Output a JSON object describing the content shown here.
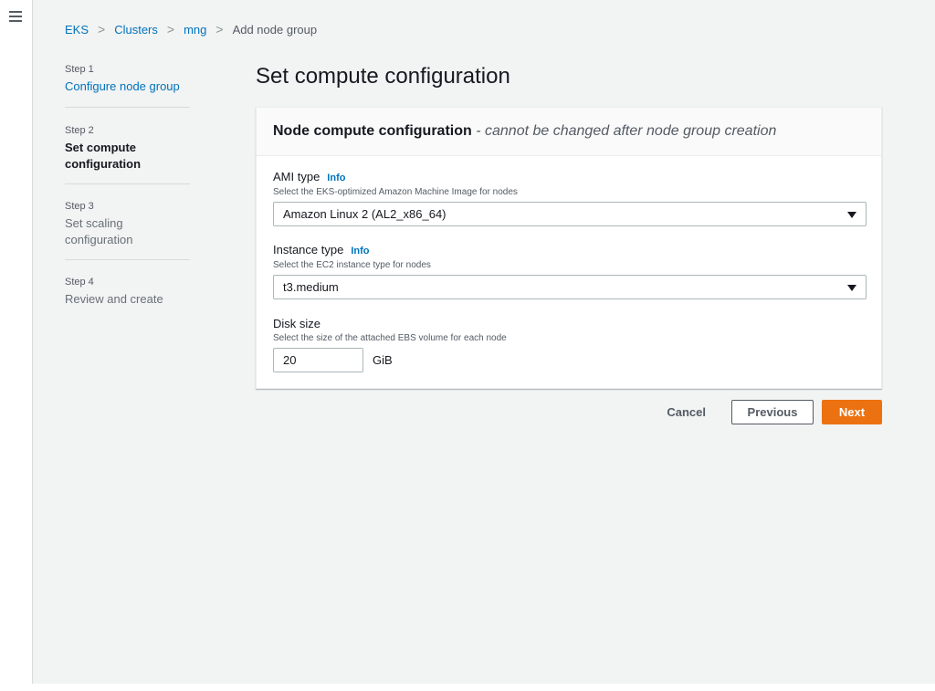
{
  "breadcrumb": [
    {
      "label": "EKS"
    },
    {
      "label": "Clusters"
    },
    {
      "label": "mng"
    },
    {
      "label": "Add node group"
    }
  ],
  "steps": [
    {
      "num": "Step 1",
      "label": "Configure node group"
    },
    {
      "num": "Step 2",
      "label": "Set compute configuration"
    },
    {
      "num": "Step 3",
      "label": "Set scaling configuration"
    },
    {
      "num": "Step 4",
      "label": "Review and create"
    }
  ],
  "page_title": "Set compute configuration",
  "panel": {
    "title": "Node compute configuration",
    "subtitle": "- cannot be changed after node group creation"
  },
  "ami": {
    "label": "AMI type",
    "info": "Info",
    "description": "Select the EKS-optimized Amazon Machine Image for nodes",
    "value": "Amazon Linux 2 (AL2_x86_64)"
  },
  "instance": {
    "label": "Instance type",
    "info": "Info",
    "description": "Select the EC2 instance type for nodes",
    "value": "t3.medium"
  },
  "disk": {
    "label": "Disk size",
    "description": "Select the size of the attached EBS volume for each node",
    "value": "20",
    "unit": "GiB"
  },
  "actions": {
    "cancel": "Cancel",
    "previous": "Previous",
    "next": "Next"
  },
  "colors": {
    "link": "#0073bb",
    "primary": "#ec7211",
    "background": "#f2f3f3"
  },
  "icons": [
    "menu-icon",
    "chevron-right-icon",
    "caret-down-icon"
  ]
}
